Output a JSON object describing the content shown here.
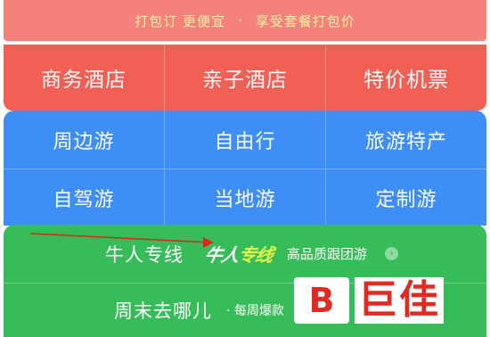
{
  "banner": {
    "left": "打包订 更便宜",
    "separator": "·",
    "right": "享受套餐打包价"
  },
  "hotel_row": [
    "商务酒店",
    "亲子酒店",
    "特价机票"
  ],
  "travel_row1": [
    "周边游",
    "自由行",
    "旅游特产"
  ],
  "travel_row2": [
    "自驾游",
    "当地游",
    "定制游"
  ],
  "niuren": {
    "label": "牛人专线",
    "logo_a": "牛人",
    "logo_b": "专线",
    "subtitle": "高品质跟团游",
    "chevron": "›"
  },
  "weekend": {
    "label": "周末去哪儿",
    "subtitle": "· 每周爆款"
  },
  "watermark": {
    "mark": "B",
    "text": "巨佳"
  },
  "colors": {
    "hotel": "#f15f55",
    "travel": "#3e8ef7",
    "green": "#36bc58",
    "banner": "#f4827a",
    "banner_text": "#fff4a8",
    "arrow": "#e0251b",
    "watermark": "#e12a22"
  }
}
